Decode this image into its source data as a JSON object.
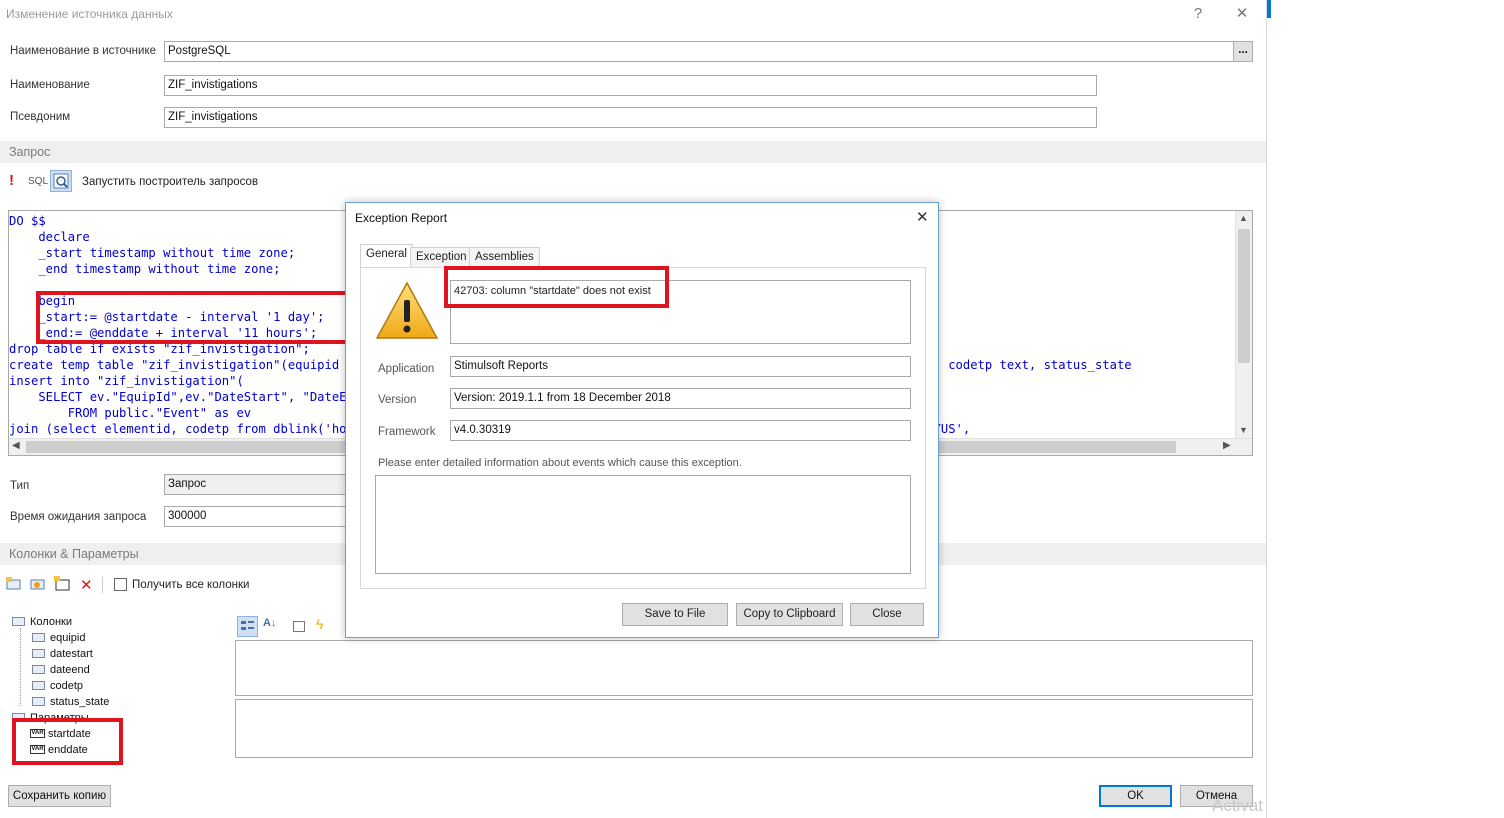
{
  "window": {
    "title": "Изменение источника данных",
    "help_glyph": "?",
    "close_glyph": "✕"
  },
  "form": {
    "source_name_label": "Наименование в источнике",
    "source_name_value": "PostgreSQL",
    "browse_label": "...",
    "name_label": "Наименование",
    "name_value": "ZIF_invistigations",
    "alias_label": "Псевдоним",
    "alias_value": "ZIF_invistigations"
  },
  "query_section": {
    "title": "Запрос",
    "sql_label": "SQL",
    "query_builder_label": "Запустить построитель запросов",
    "lines": [
      "DO $$",
      "    declare",
      "    _start timestamp without time zone;",
      "    _end timestamp without time zone;",
      "",
      "    begin",
      "    _start:= @startdate - interval '1 day';",
      "    _end:= @enddate + interval '11 hours';",
      "drop table if exists \"zif_invistigation\";",
      "create temp table \"zif_invistigation\"(equipid text, datestart timestamp without time zone, dateend timestamp without time zone, codetp text, status_state",
      "insert into \"zif_invistigation\"(",
      "    SELECT ev.\"EquipId\",ev.\"DateStart\", \"DateEnd\"",
      "        FROM public.\"Event\" as ev",
      "join (select elementid, codetp from dblink('hostaddr=10.0.0.1 port=5432 dbname=zif user=postgres password=1qazXSW@erty2020#POLYUS',"
    ]
  },
  "type_field": {
    "label": "Тип",
    "value": "Запрос"
  },
  "timeout_field": {
    "label": "Время ожидания запроса",
    "value": "300000"
  },
  "columns_section": {
    "title": "Колонки & Параметры",
    "get_all_columns_label": "Получить все колонки"
  },
  "tree": {
    "columns_label": "Колонки",
    "columns": [
      "equipid",
      "datestart",
      "dateend",
      "codetp",
      "status_state"
    ],
    "params_label": "Параметры",
    "params": [
      "startdate",
      "enddate"
    ],
    "var_badge": "VAR"
  },
  "footer": {
    "save_copy_label": "Сохранить копию",
    "ok_label": "OK",
    "cancel_label": "Отмена",
    "watermark": "Activat"
  },
  "exception_dialog": {
    "title": "Exception Report",
    "close_glyph": "✕",
    "tabs": [
      "General",
      "Exception",
      "Assemblies"
    ],
    "message": "42703: column \"startdate\" does not exist",
    "application_label": "Application",
    "application_value": "Stimulsoft Reports",
    "version_label": "Version",
    "version_value": "Version: 2019.1.1 from 18 December 2018",
    "framework_label": "Framework",
    "framework_value": "v4.0.30319",
    "prompt": "Please enter detailed information about events which cause this exception.",
    "save_button": "Save to File",
    "copy_button": "Copy to Clipboard",
    "close_button": "Close"
  },
  "colors": {
    "highlight_red": "#e0141e",
    "sql_keyword": "#0000c8",
    "sql_string": "#b00000",
    "ok_border": "#0078d7"
  }
}
